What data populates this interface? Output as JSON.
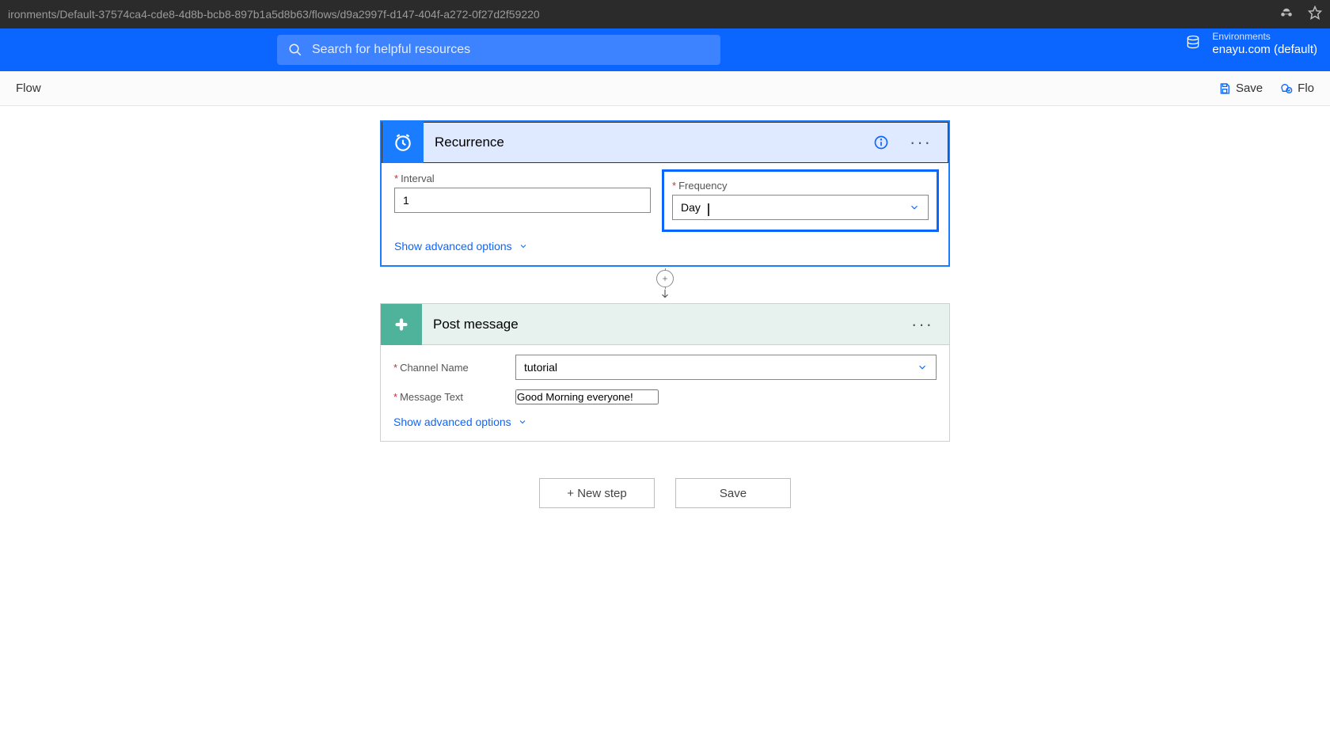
{
  "browser": {
    "url": "ironments/Default-37574ca4-cde8-4d8b-bcb8-897b1a5d8b63/flows/d9a2997f-d147-404f-a272-0f27d2f59220"
  },
  "header": {
    "search_placeholder": "Search for helpful resources",
    "env_label": "Environments",
    "env_value": "enayu.com (default)"
  },
  "commandbar": {
    "title": "Flow",
    "save": "Save",
    "flow_checker": "Flo"
  },
  "trigger": {
    "title": "Recurrence",
    "interval_label": "Interval",
    "interval_value": "1",
    "frequency_label": "Frequency",
    "frequency_value": "Day",
    "advanced": "Show advanced options"
  },
  "action": {
    "title": "Post message",
    "channel_label": "Channel Name",
    "channel_value": "tutorial",
    "message_label": "Message Text",
    "message_value": "Good Morning everyone!",
    "advanced": "Show advanced options"
  },
  "bottom": {
    "new_step": "+ New step",
    "save": "Save"
  }
}
